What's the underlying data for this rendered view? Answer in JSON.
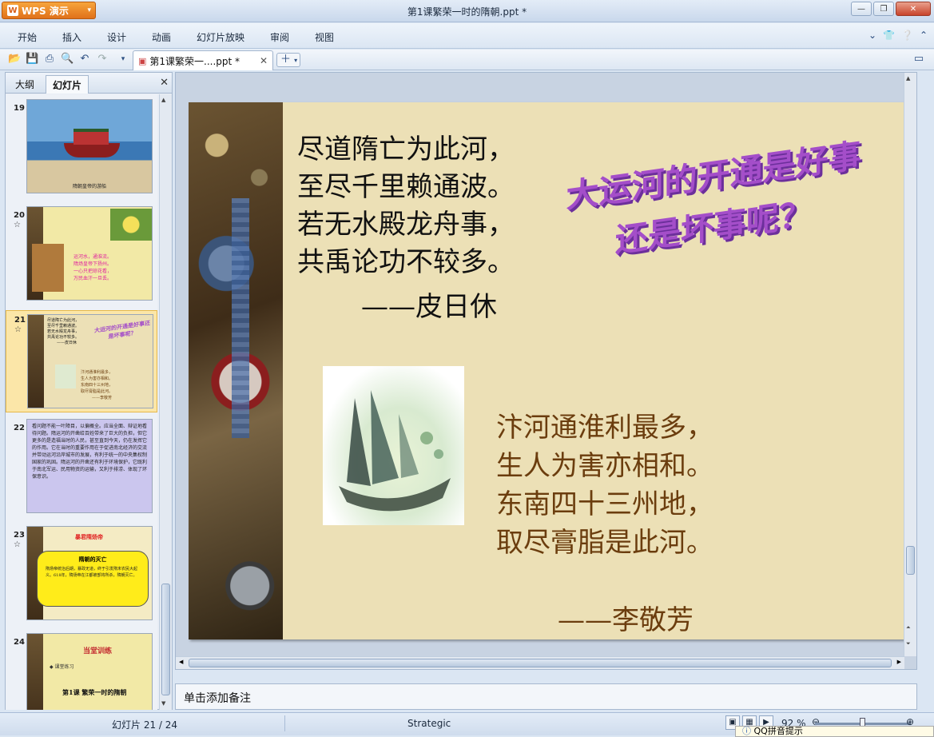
{
  "window": {
    "app_button": "WPS 演示",
    "title": "第1课繁荣一时的隋朝.ppt *"
  },
  "menu": {
    "items": [
      "开始",
      "插入",
      "设计",
      "动画",
      "幻灯片放映",
      "审阅",
      "视图"
    ]
  },
  "toolbar": {
    "doc_tab_label": "第1课繁荣一....ppt *"
  },
  "left_panel": {
    "tabs": [
      "大纲",
      "幻灯片"
    ],
    "thumbnails": [
      {
        "number": "19",
        "caption": "隋朝皇帝的游船",
        "star": ""
      },
      {
        "number": "20",
        "star": "☆",
        "lines": [
          "运河水，通淮流。",
          "隋炀皇帝下扬州。",
          "一心只把琼花看，",
          "万民血汗一旦丢。"
        ]
      },
      {
        "number": "21",
        "star": "☆",
        "selected": true,
        "lines": [
          "尽道隋亡为此河，",
          "至尽千里赖通波。",
          "若无水殿龙舟事，",
          "共禹论功不较多。",
          "——皮日休"
        ],
        "wordart": "大运河的开通是好事还是坏事呢？",
        "lines2": [
          "汴河通淮利最多，",
          "生人为害亦相和。",
          "东南四十三州地，",
          "取尽膏脂是此河。",
          "——李敬芳"
        ]
      },
      {
        "number": "22",
        "star": "",
        "text": "看问题不能一叶障目，以偏概全。应当全面、辩证地看待问题。隋运河的开凿给百姓带来了巨大的负担，但它更多的是造福当时的人民，甚至直到今天，仍在发挥它的作用。它在当时的重要作用在于促进南北经济的交流并带动运河沿岸城市的发展，有利于统一的中央集权制国家的巩固。隋运河的开凿还有利于环境保护，它既利于南北军运、民用物资的运输，又利于排涝、体现了环保意识。"
      },
      {
        "number": "23",
        "star": "☆",
        "title": "暴君隋炀帝",
        "bubble_title": "隋朝的灭亡",
        "bubble_text": "隋炀帝统治后期，暴政无道，终于引发隋末农民大起义。618年，隋炀帝在江都被部将所杀，隋朝灭亡。"
      },
      {
        "number": "24",
        "star": "",
        "title": "当堂训练",
        "bullet": "课堂练习",
        "footer": "第1课  繁荣一时的隋朝"
      }
    ]
  },
  "slide": {
    "poem1_lines": [
      "尽道隋亡为此河，",
      "至尽千里赖通波。",
      "若无水殿龙舟事，",
      "共禹论功不较多。"
    ],
    "poem1_author": "——皮日休",
    "wordart_line1": "大运河的开通是好事",
    "wordart_line2": "还是坏事呢？",
    "poem2_lines": [
      "汴河通淮利最多，",
      "生人为害亦相和。",
      "东南四十三州地，",
      "取尽膏脂是此河。"
    ],
    "poem2_author": "——李敬芳"
  },
  "notes_placeholder": "单击添加备注",
  "status": {
    "slide_counter": "幻灯片 21 / 24",
    "theme": "Strategic",
    "zoom": "92 %",
    "qq_tip": "QQ拼音提示"
  }
}
